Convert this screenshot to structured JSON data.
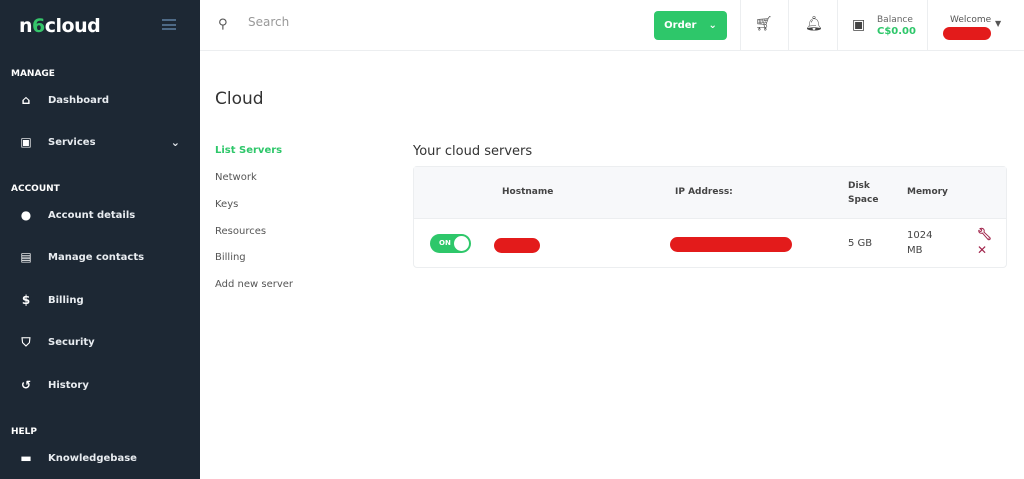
{
  "sidebar": {
    "logo": {
      "prefix": "n",
      "six": "6",
      "suffix": "cloud"
    },
    "sections": {
      "manage": "MANAGE",
      "account": "ACCOUNT",
      "help": "HELP"
    },
    "items": [
      {
        "label": "Dashboard",
        "icon": "home-icon"
      },
      {
        "label": "Services",
        "icon": "id-card-icon"
      },
      {
        "label": "Account details",
        "icon": "user-icon"
      },
      {
        "label": "Manage contacts",
        "icon": "contacts-icon"
      },
      {
        "label": "Billing",
        "icon": "dollar-icon"
      },
      {
        "label": "Security",
        "icon": "shield-icon"
      },
      {
        "label": "History",
        "icon": "history-icon"
      },
      {
        "label": "Knowledgebase",
        "icon": "book-icon"
      }
    ]
  },
  "topbar": {
    "search_placeholder": "Search",
    "order_label": "Order",
    "balance_label": "Balance",
    "balance_value": "C$0.00",
    "welcome_label": "Welcome"
  },
  "page": {
    "title": "Cloud",
    "submenu": [
      "List Servers",
      "Network",
      "Keys",
      "Resources",
      "Billing",
      "Add new server"
    ]
  },
  "servers": {
    "title": "Your cloud servers",
    "columns": {
      "hostname": "Hostname",
      "ip": "IP Address:",
      "disk1": "Disk",
      "disk2": "Space",
      "memory": "Memory"
    },
    "rows": [
      {
        "status": "ON",
        "disk": "5 GB",
        "mem1": "1024",
        "mem2": "MB"
      }
    ]
  },
  "colors": {
    "accent": "#2ec76a",
    "sidebar": "#1d2834"
  }
}
